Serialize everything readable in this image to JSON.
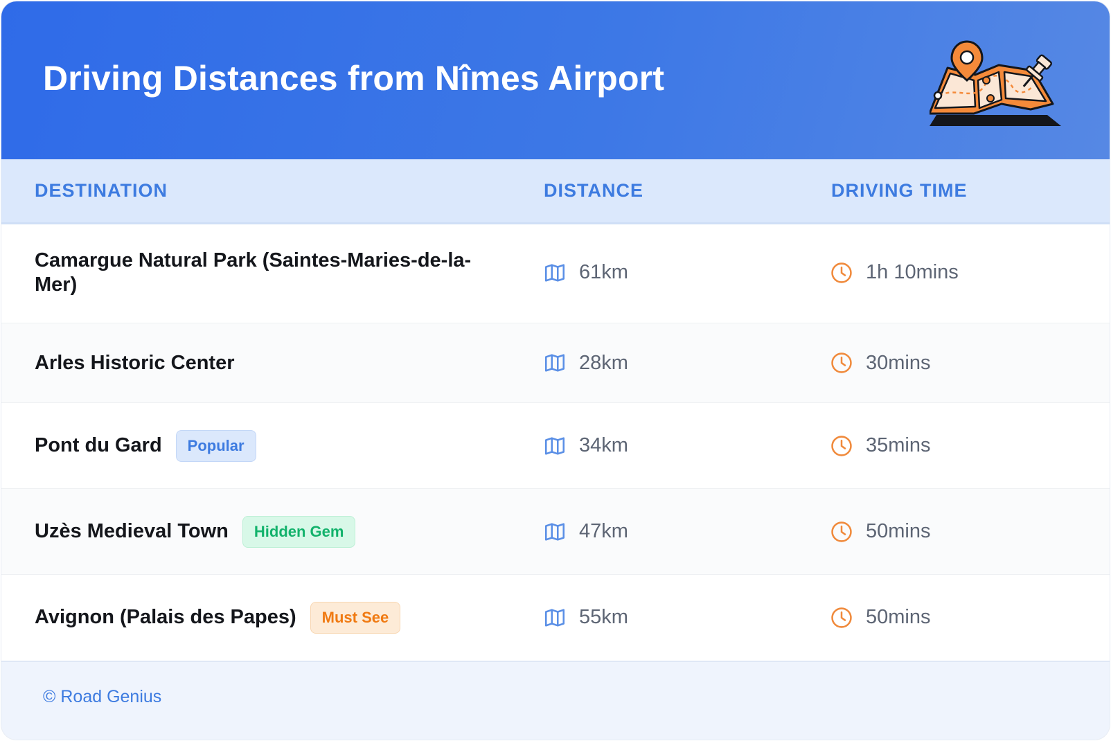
{
  "header": {
    "title": "Driving Distances from Nîmes Airport"
  },
  "table": {
    "columns": [
      "DESTINATION",
      "DISTANCE",
      "DRIVING TIME"
    ],
    "rows": [
      {
        "destination": "Camargue Natural Park (Saintes-Maries-de-la-Mer)",
        "badge": null,
        "distance": "61km",
        "time": "1h 10mins"
      },
      {
        "destination": "Arles Historic Center",
        "badge": null,
        "distance": "28km",
        "time": "30mins"
      },
      {
        "destination": "Pont du Gard",
        "badge": "Popular",
        "distance": "34km",
        "time": "35mins"
      },
      {
        "destination": "Uzès Medieval Town",
        "badge": "Hidden Gem",
        "distance": "47km",
        "time": "50mins"
      },
      {
        "destination": "Avignon (Palais des Papes)",
        "badge": "Must See",
        "distance": "55km",
        "time": "50mins"
      }
    ]
  },
  "icons": {
    "distance": "map-icon",
    "time": "clock-icon",
    "header": "map-pin-illustration"
  },
  "colors": {
    "accent": "#3d7be0",
    "header_bg": "#2f6be8",
    "icon_distance": "#5a8fe6",
    "icon_time": "#f08a3c",
    "badge_popular": "#3d7be0",
    "badge_hidden_gem": "#12b26b",
    "badge_must_see": "#f07a12"
  },
  "footer": {
    "copyright": "© Road Genius"
  }
}
